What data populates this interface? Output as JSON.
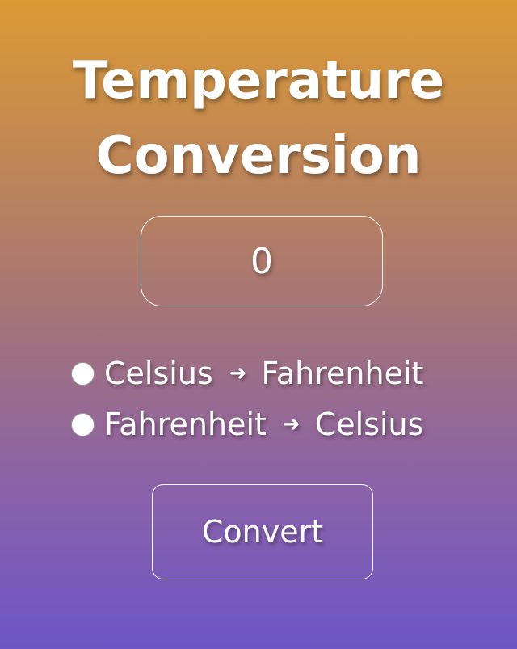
{
  "title": {
    "line1": "Temperature",
    "line2": "Conversion"
  },
  "input": {
    "value": "0"
  },
  "options": [
    {
      "from": "Celsius",
      "arrow": "➜",
      "to": "Fahrenheit",
      "selected": false
    },
    {
      "from": "Fahrenheit",
      "arrow": "➜",
      "to": "Celsius",
      "selected": false
    }
  ],
  "convert_button": {
    "label": "Convert"
  },
  "colors": {
    "gradient_top": "#dc9a34",
    "gradient_bottom": "#6d55c6",
    "text": "#ffffff"
  }
}
